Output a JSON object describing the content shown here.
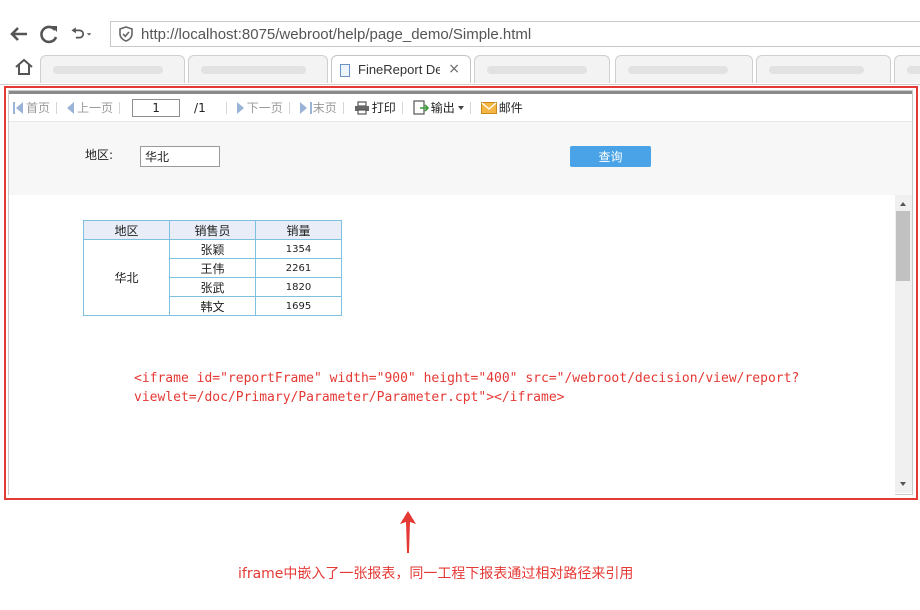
{
  "browser": {
    "url": "http://localhost:8075/webroot/help/page_demo/Simple.html",
    "active_tab_title": "FineReport Demo",
    "active_tab_close": "×"
  },
  "toolbar": {
    "first_page": "首页",
    "prev_page": "上一页",
    "page_number": "1",
    "page_total": "/1",
    "next_page": "下一页",
    "last_page": "末页",
    "print": "打印",
    "export": "输出",
    "mail": "邮件"
  },
  "parameters": {
    "region_label": "地区:",
    "region_value": "华北",
    "query_button": "查询"
  },
  "report_table": {
    "headers": [
      "地区",
      "销售员",
      "销量"
    ],
    "region": "华北",
    "rows": [
      {
        "salesperson": "张颖",
        "amount": "1354"
      },
      {
        "salesperson": "王伟",
        "amount": "2261"
      },
      {
        "salesperson": "张武",
        "amount": "1820"
      },
      {
        "salesperson": "韩文",
        "amount": "1695"
      }
    ]
  },
  "code_snippet": {
    "line1": "<iframe id=\"reportFrame\" width=\"900\" height=\"400\" src=\"/webroot/decision/view/report?",
    "line2": "viewlet=/doc/Primary/Parameter/Parameter.cpt\"></iframe>"
  },
  "annotation": "iframe中嵌入了一张报表，同一工程下报表通过相对路径来引用",
  "colors": {
    "highlight_red": "#e53935",
    "query_button": "#4aa3e6",
    "table_border": "#7ec0e0",
    "table_header": "#e8edf7"
  }
}
